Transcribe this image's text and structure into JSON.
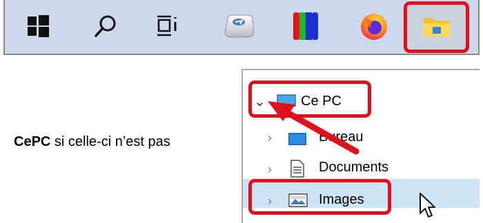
{
  "taskbar": {
    "items": [
      {
        "name": "Windows Start",
        "icon": "windows-logo-icon"
      },
      {
        "name": "Search",
        "icon": "search-icon"
      },
      {
        "name": "Task View",
        "icon": "task-view-icon"
      },
      {
        "name": "Keyboard app",
        "icon": "keyboard-key-icon"
      },
      {
        "name": "Color bars app",
        "icon": "color-bars-icon"
      },
      {
        "name": "Firefox",
        "icon": "firefox-icon"
      },
      {
        "name": "File Explorer",
        "icon": "folder-icon",
        "highlighted": true
      }
    ],
    "highlight_color": "#e0101c"
  },
  "caption": {
    "bold": "CePC",
    "rest": " si celle-ci n’est pas"
  },
  "explorer": {
    "items": [
      {
        "label": "Ce PC",
        "icon": "monitor-icon",
        "expanded": true,
        "highlighted": true
      },
      {
        "label": "Bureau",
        "icon": "desktop-folder-icon"
      },
      {
        "label": "Documents",
        "icon": "document-icon"
      },
      {
        "label": "Images",
        "icon": "image-icon",
        "selected": true,
        "highlighted": true
      }
    ],
    "selection_color": "#cce4f7"
  }
}
